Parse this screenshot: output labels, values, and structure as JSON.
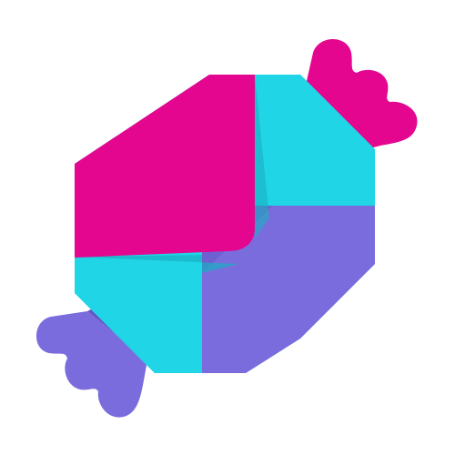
{
  "logo": {
    "icon": "candy-envelope-icon",
    "colors": {
      "background": "#ffffff",
      "magenta": "#E4068F",
      "magenta_shade": "#B80A78",
      "cyan": "#20D5E6",
      "cyan_shade": "#1AAFC2",
      "purple": "#7A6CDD",
      "purple_shade": "#6457C4"
    }
  }
}
